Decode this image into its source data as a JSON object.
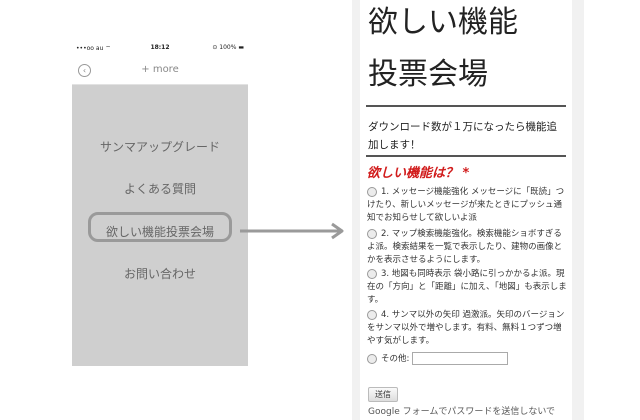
{
  "phone": {
    "status": {
      "carrier": "•••oo au ⌔",
      "time": "18:12",
      "battery": "⊙ 100% ▬"
    },
    "nav_title": "+ more",
    "back_icon": "back-arrow-circle",
    "menu": [
      "サンマアップグレード",
      "よくある質問",
      "欲しい機能投票会場",
      "お問い合わせ"
    ]
  },
  "form": {
    "title_line1": "欲しい機能",
    "title_line2": "投票会場",
    "description": "ダウンロード数が１万になったら機能追加します！",
    "question": "欲しい機能は？ *",
    "options": [
      "1. メッセージ機能強化 メッセージに「既読」つけたり、新しいメッセージが来たときにプッシュ通知でお知らせして欲しいよ派",
      "2. マップ検索機能強化。検索機能ショボすぎるよ派。検索結果を一覧で表示したり、建物の画像とかを表示させるようにします。",
      "3. 地図も同時表示 袋小路に引っかかるよ派。現在の「方向」と「距離」に加え、「地図」も表示します。",
      "4. サンマ以外の矢印 過激派。矢印のバージョンをサンマ以外で増やします。有料、無料１つずつ増やす気がします。"
    ],
    "other_label": "その他:",
    "submit_label": "送信",
    "note": "Google フォームでパスワードを送信しないで"
  },
  "colors": {
    "question_red": "#d11c1c",
    "phone_gray": "#cfcfcf"
  }
}
